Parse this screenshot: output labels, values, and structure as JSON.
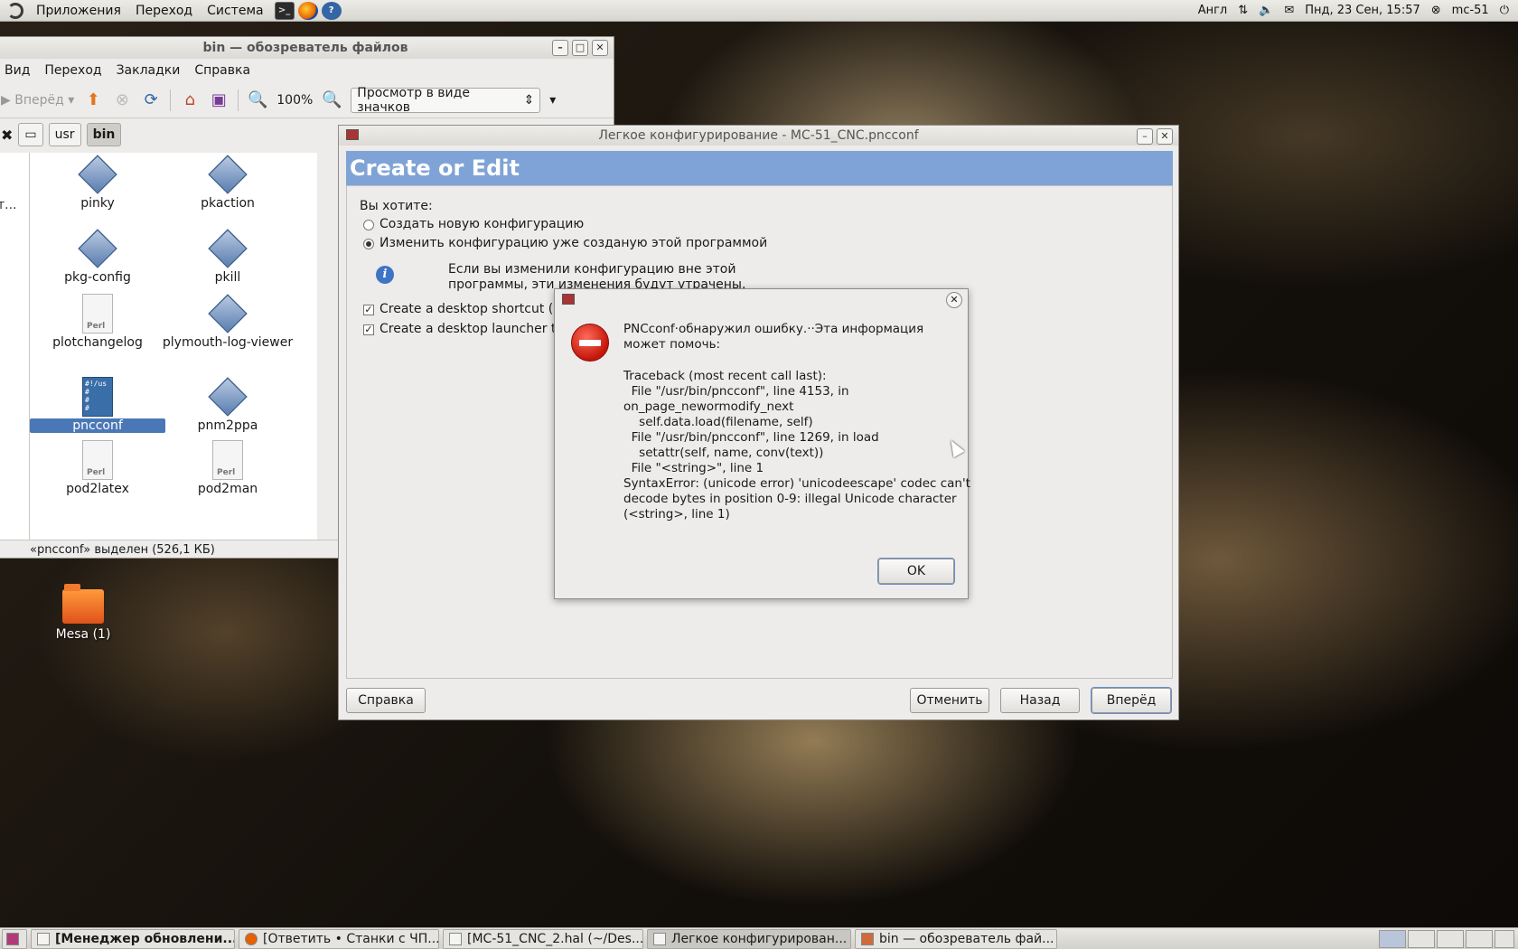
{
  "top_panel": {
    "menus": [
      "Приложения",
      "Переход",
      "Система"
    ],
    "keyboard": "Англ",
    "clock": "Пнд, 23 Сен, 15:57",
    "user": "mc-51"
  },
  "file_manager": {
    "title": "bin — обозреватель файлов",
    "menu": [
      "Вид",
      "Переход",
      "Закладки",
      "Справка"
    ],
    "forward_label": "Вперёд",
    "zoom": "100%",
    "view_mode": "Просмотр в виде значков",
    "path": [
      "usr",
      "bin"
    ],
    "side_truncated": "т...",
    "items": [
      {
        "name": "pinky",
        "type": "exec"
      },
      {
        "name": "pkaction",
        "type": "exec"
      },
      {
        "name": "pkg-config",
        "type": "exec"
      },
      {
        "name": "pkill",
        "type": "exec"
      },
      {
        "name": "plotchangelog",
        "type": "perl"
      },
      {
        "name": "plymouth-log-viewer",
        "type": "exec"
      },
      {
        "name": "pncconf",
        "type": "script",
        "selected": true
      },
      {
        "name": "pnm2ppa",
        "type": "exec"
      },
      {
        "name": "pod2latex",
        "type": "perl"
      },
      {
        "name": "pod2man",
        "type": "perl"
      }
    ],
    "status": "«pncconf» выделен (526,1 КБ)"
  },
  "desktop": {
    "icons": [
      {
        "label": "Mesa (1)"
      }
    ]
  },
  "pncconf": {
    "title": "Легкое конфигурирование - MC-51_CNC.pncconf",
    "banner": "Create or Edit",
    "question": "Вы хотите:",
    "options": [
      {
        "label": "Создать новую конфигурацию",
        "selected": false
      },
      {
        "label": "Изменить конфигурацию уже созданую этой программой",
        "selected": true
      }
    ],
    "info_text_line1": "Если вы изменили конфигурацию вне этой",
    "info_text_line2": "программы, эти изменения будут утрачены.",
    "checkboxes": [
      {
        "label": "Create a desktop shortcut (sy",
        "checked": true
      },
      {
        "label": "Create a desktop launcher to",
        "checked": true
      }
    ],
    "buttons": {
      "help": "Справка",
      "cancel": "Отменить",
      "back": "Назад",
      "forward": "Вперёд"
    }
  },
  "error_dialog": {
    "message": "PNCconf·обнаружил ошибку.··Эта информация может помочь:",
    "traceback": "Traceback (most recent call last):\n  File \"/usr/bin/pncconf\", line 4153, in\non_page_newormodify_next\n    self.data.load(filename, self)\n  File \"/usr/bin/pncconf\", line 1269, in load\n    setattr(self, name, conv(text))\n  File \"<string>\", line 1\nSyntaxError: (unicode error) 'unicodeescape' codec can't\ndecode bytes in position 0-9: illegal Unicode character\n(<string>, line 1)",
    "ok": "OK"
  },
  "taskbar": {
    "tasks": [
      {
        "label": "[Менеджер обновлени...",
        "active": false,
        "bold": true
      },
      {
        "label": "[Ответить • Станки с ЧП...",
        "active": false,
        "bold": false
      },
      {
        "label": "[MC-51_CNC_2.hal (~/Des...",
        "active": false,
        "bold": false
      },
      {
        "label": "Легкое конфигурирован...",
        "active": true,
        "bold": false
      },
      {
        "label": "bin — обозреватель фай...",
        "active": false,
        "bold": false
      }
    ]
  }
}
